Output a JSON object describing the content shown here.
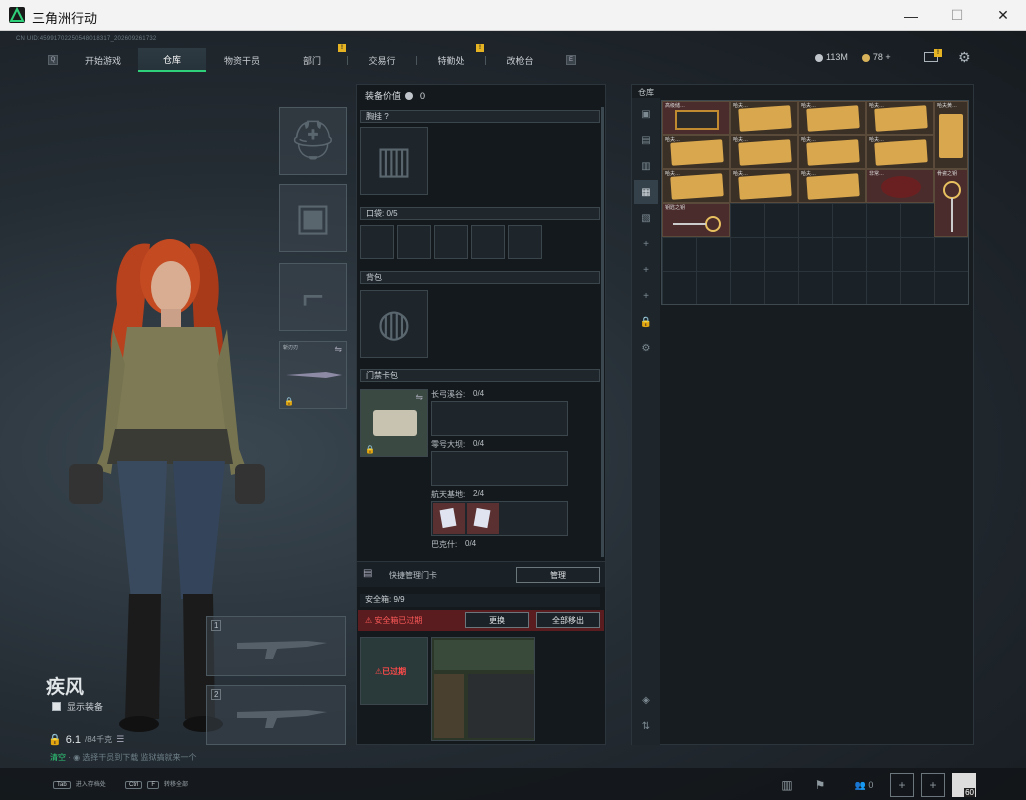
{
  "window": {
    "title": "三角洲行动",
    "minimize": "—",
    "maximize": "☐",
    "close": "✕"
  },
  "uid": "CN UID:459917022505480183​17_2026092617​32",
  "nav": {
    "left_key": "Q",
    "right_key": "E",
    "tabs": [
      "开始游戏",
      "仓库",
      "物资干员",
      "部门",
      "交易行",
      "特勤处",
      "改枪台"
    ],
    "active_index": 1,
    "badge_mark": "!"
  },
  "currency": {
    "silver": "113M",
    "gold": "78",
    "gold_plus": "+"
  },
  "operator": {
    "name": "疾风",
    "show_equipment": "显示装备",
    "weight": "6.1",
    "weight_max": "/84千克",
    "hint_green": "清空",
    "hint_rest": "  ·  ◉ 选择干员到下载  监狱搞就来一个",
    "slot_numbers": [
      "1",
      "2"
    ],
    "melee_label": "斩刃刃"
  },
  "equip_panel": {
    "value_label": "装备价值",
    "value": "0",
    "chest": "胸挂",
    "chest_q": "?",
    "pocket": "口袋:",
    "pocket_count": "0",
    "pocket_total": "/5",
    "backpack": "背包",
    "keycard": "门禁卡包",
    "keycard_rows": [
      {
        "label": "长弓溪谷:",
        "count": "0/4"
      },
      {
        "label": "零号大坝:",
        "count": "0/4"
      },
      {
        "label": "航天基地:",
        "count": "2/4"
      },
      {
        "label": "巴克什:",
        "count": "0/4"
      }
    ],
    "quick_manage": "快捷管理门卡",
    "manage_btn": "管理",
    "safe_label": "安全箱:",
    "safe_count": "9",
    "safe_unit": "/9",
    "safe_expired": "安全箱已过期",
    "replace_btn": "更换",
    "move_all_btn": "全部移出",
    "expired_tag": "已过期"
  },
  "warehouse": {
    "title": "仓库",
    "item_labels": [
      "高级储…",
      "哈夫…",
      "哈夫…",
      "哈夫…",
      "哈夫黄…",
      "哈夫…",
      "哈夫…",
      "哈夫…",
      "哈夫…",
      "哈夫…",
      "哈夫…",
      "哈夫…",
      "非常…",
      "钥匙之钥",
      "骨瓷之钥"
    ]
  },
  "bottom": {
    "tab_key": "Tab",
    "tab_text": "进入存档处",
    "ctrl_key": "Ctrl",
    "f_key": "F",
    "ctrl_text": "转移全部",
    "friends": "0",
    "level": "60"
  }
}
